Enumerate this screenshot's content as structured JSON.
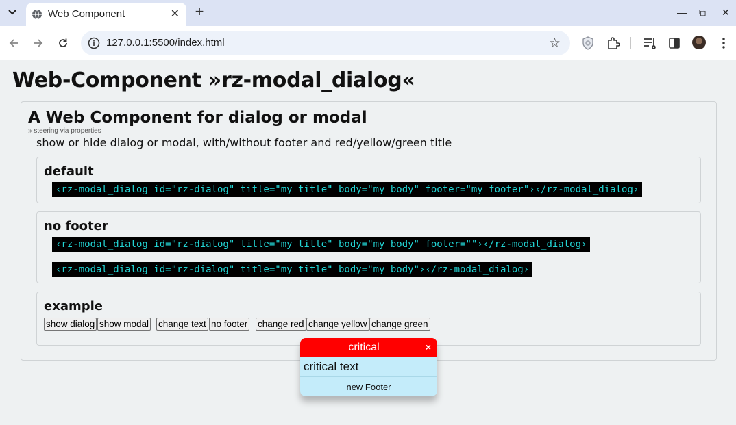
{
  "browser": {
    "tab_title": "Web Component",
    "tab_close": "✕",
    "new_tab": "+",
    "url": "127.0.0.1:5500/index.html",
    "window_controls": {
      "minimize": "—",
      "restore": "⧉",
      "close": "✕"
    },
    "icons": [
      "tab-search-icon",
      "globe-icon",
      "back-icon",
      "forward-icon",
      "reload-icon",
      "info-icon",
      "bookmark-star-icon",
      "shield-extension-icon",
      "puzzle-extensions-icon",
      "reading-list-icon",
      "side-panel-icon",
      "profile-avatar",
      "kebab-menu-icon"
    ]
  },
  "page": {
    "title": "Web-Component »rz-modal_dialog«",
    "section_title": "A Web Component for dialog or modal",
    "section_subtitle": "» steering via properties",
    "description": "show or hide dialog or modal, with/without footer and red/yellow/green title",
    "cards": {
      "default": {
        "title": "default",
        "code": "‹rz-modal_dialog id=\"rz-dialog\" title=\"my title\" body=\"my body\" footer=\"my footer\"›‹/rz-modal_dialog›"
      },
      "no_footer": {
        "title": "no footer",
        "code_1": "‹rz-modal_dialog id=\"rz-dialog\" title=\"my title\" body=\"my body\" footer=\"\"›‹/rz-modal_dialog›",
        "code_2": "‹rz-modal_dialog id=\"rz-dialog\" title=\"my title\" body=\"my body\"›‹/rz-modal_dialog›"
      },
      "example": {
        "title": "example",
        "buttons": {
          "show_dialog": "show dialog",
          "show_modal": "show modal",
          "change_text": "change text",
          "no_footer": "no footer",
          "change_red": "change red",
          "change_yellow": "change yellow",
          "change_green": "change green"
        }
      }
    }
  },
  "dialog": {
    "title": "critical",
    "close": "×",
    "body": "critical text",
    "footer": "new Footer",
    "colors": {
      "header": "#ff0000",
      "body": "#c4ecfa"
    }
  },
  "colors": {
    "page_bg": "#eef1f2",
    "tabbar_bg": "#dce3f4",
    "code_bg": "#000000",
    "code_fg": "#22d3d3"
  }
}
